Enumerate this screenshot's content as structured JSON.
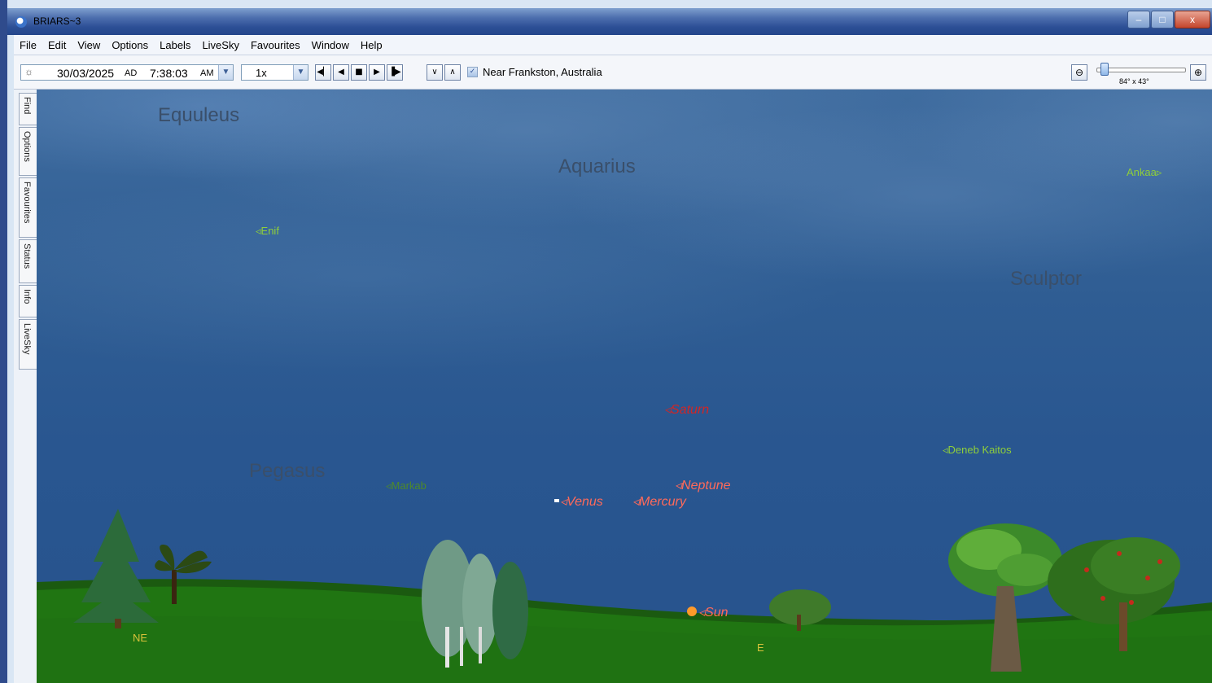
{
  "window": {
    "title": "BRIARS~3",
    "buttons": {
      "minimize": "–",
      "maximize": "□",
      "close": "x"
    }
  },
  "menu": [
    "File",
    "Edit",
    "View",
    "Options",
    "Labels",
    "LiveSky",
    "Favourites",
    "Window",
    "Help"
  ],
  "toolbar": {
    "sun_glyph": "☼",
    "date": "30/03/2025",
    "era": "AD",
    "time": "7:38:03",
    "meridiem": "AM",
    "speed": "1x",
    "transport_glyphs": [
      "◀▏",
      "◀",
      "■",
      "▶",
      "▐▶"
    ],
    "nav_glyphs": [
      "∨",
      "∧"
    ],
    "location_checked_glyph": "✓",
    "location": "Near Frankston, Australia",
    "zoom_out_glyph": "⊖",
    "zoom_in_glyph": "⊕",
    "zoom_level": 0.05,
    "fov": "84° x 43°"
  },
  "side_tabs": [
    "Find",
    "Options",
    "Favourites",
    "Status",
    "Info",
    "LiveSky"
  ],
  "sky": {
    "constellations": [
      "Equuleus",
      "Aquarius",
      "Sculptor",
      "Pegasus"
    ],
    "stars": [
      "◃Enif",
      "Ankaa▹",
      "◃Deneb Kaitos",
      "◃Markab"
    ],
    "planets": [
      "◃Saturn",
      "◃Neptune",
      "◃Venus",
      "◃Mercury",
      "◃Sun"
    ],
    "compass": [
      "NE",
      "E"
    ]
  },
  "colors": {
    "sky": "#2f5d93",
    "ground": "#1f6a12",
    "star_label": "#8fcf3a",
    "planet_label": "#ff6a5a",
    "constellation": "#3a4f6a",
    "compass": "#d8c23a"
  }
}
